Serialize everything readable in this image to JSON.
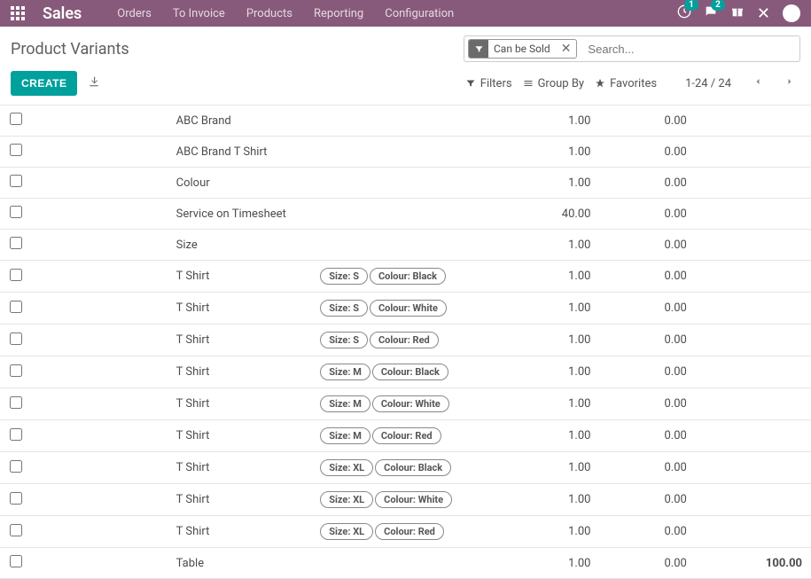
{
  "topbar": {
    "brand": "Sales",
    "nav": [
      "Orders",
      "To Invoice",
      "Products",
      "Reporting",
      "Configuration"
    ],
    "badge1": "1",
    "badge2": "2"
  },
  "breadcrumb": {
    "title": "Product Variants"
  },
  "search": {
    "facet_label": "Can be Sold",
    "placeholder": "Search..."
  },
  "actions": {
    "create": "CREATE",
    "filters": "Filters",
    "groupby": "Group By",
    "favorites": "Favorites",
    "pager": "1-24 / 24"
  },
  "rows": [
    {
      "name": "ABC Brand",
      "attrs": [],
      "q1": "1.00",
      "q2": "0.00",
      "q3": ""
    },
    {
      "name": "ABC Brand T Shirt",
      "attrs": [],
      "q1": "1.00",
      "q2": "0.00",
      "q3": ""
    },
    {
      "name": "Colour",
      "attrs": [],
      "q1": "1.00",
      "q2": "0.00",
      "q3": ""
    },
    {
      "name": "Service on Timesheet",
      "attrs": [],
      "q1": "40.00",
      "q2": "0.00",
      "q3": ""
    },
    {
      "name": "Size",
      "attrs": [],
      "q1": "1.00",
      "q2": "0.00",
      "q3": ""
    },
    {
      "name": "T Shirt",
      "attrs": [
        "Size: S",
        "Colour: Black"
      ],
      "q1": "1.00",
      "q2": "0.00",
      "q3": ""
    },
    {
      "name": "T Shirt",
      "attrs": [
        "Size: S",
        "Colour: White"
      ],
      "q1": "1.00",
      "q2": "0.00",
      "q3": ""
    },
    {
      "name": "T Shirt",
      "attrs": [
        "Size: S",
        "Colour: Red"
      ],
      "q1": "1.00",
      "q2": "0.00",
      "q3": ""
    },
    {
      "name": "T Shirt",
      "attrs": [
        "Size: M",
        "Colour: Black"
      ],
      "q1": "1.00",
      "q2": "0.00",
      "q3": ""
    },
    {
      "name": "T Shirt",
      "attrs": [
        "Size: M",
        "Colour: White"
      ],
      "q1": "1.00",
      "q2": "0.00",
      "q3": ""
    },
    {
      "name": "T Shirt",
      "attrs": [
        "Size: M",
        "Colour: Red"
      ],
      "q1": "1.00",
      "q2": "0.00",
      "q3": ""
    },
    {
      "name": "T Shirt",
      "attrs": [
        "Size: XL",
        "Colour: Black"
      ],
      "q1": "1.00",
      "q2": "0.00",
      "q3": ""
    },
    {
      "name": "T Shirt",
      "attrs": [
        "Size: XL",
        "Colour: White"
      ],
      "q1": "1.00",
      "q2": "0.00",
      "q3": ""
    },
    {
      "name": "T Shirt",
      "attrs": [
        "Size: XL",
        "Colour: Red"
      ],
      "q1": "1.00",
      "q2": "0.00",
      "q3": ""
    },
    {
      "name": "Table",
      "attrs": [],
      "q1": "1.00",
      "q2": "0.00",
      "q3": "100.00"
    }
  ]
}
